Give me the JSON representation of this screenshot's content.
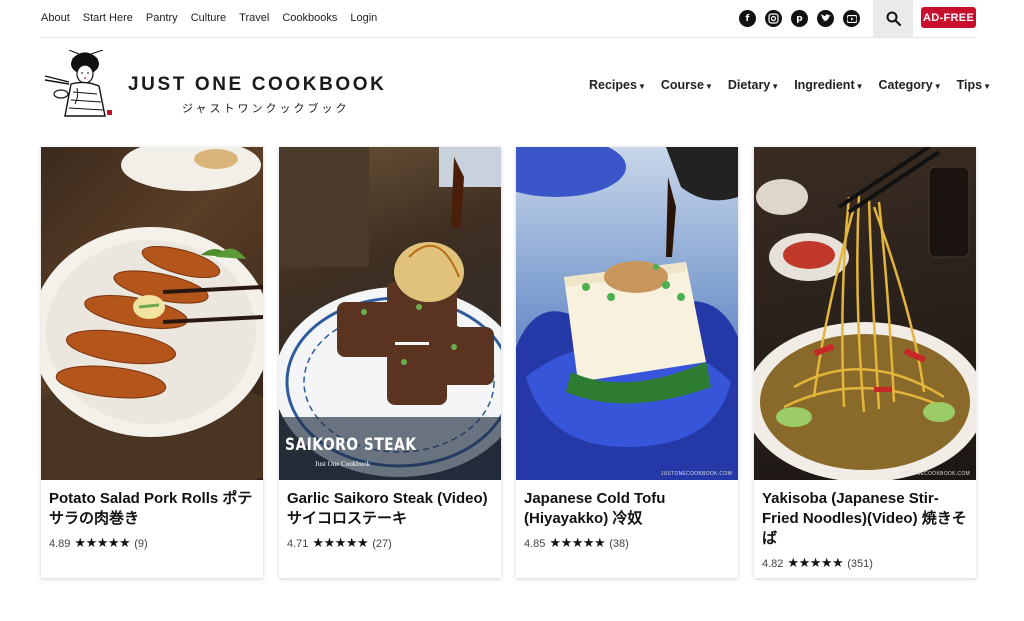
{
  "top_nav": [
    "About",
    "Start Here",
    "Pantry",
    "Culture",
    "Travel",
    "Cookbooks",
    "Login"
  ],
  "social_icons": [
    "facebook-icon",
    "instagram-icon",
    "pinterest-icon",
    "twitter-icon",
    "youtube-icon"
  ],
  "ad_free_label": "AD-FREE",
  "logo": {
    "name": "JUST ONE COOKBOOK",
    "jp": "ジャストワンクックブック"
  },
  "main_nav": [
    {
      "label": "Recipes"
    },
    {
      "label": "Course"
    },
    {
      "label": "Dietary"
    },
    {
      "label": "Ingredient"
    },
    {
      "label": "Category"
    },
    {
      "label": "Tips"
    }
  ],
  "cards": [
    {
      "title": "Potato Salad Pork Rolls ポテサラの肉巻き",
      "rating": "4.89",
      "count": "(9)",
      "stars": "★★★★★"
    },
    {
      "title": "Garlic Saikoro Steak (Video) サイコロステーキ",
      "rating": "4.71",
      "count": "(27)",
      "stars": "★★★★★",
      "overlay_title": "SAIKORO STEAK",
      "overlay_sub": "Just One Cookbook"
    },
    {
      "title": "Japanese Cold Tofu (Hiyayakko) 冷奴",
      "rating": "4.85",
      "count": "(38)",
      "stars": "★★★★★"
    },
    {
      "title": "Yakisoba (Japanese Stir-Fried Noodles)(Video) 焼きそば",
      "rating": "4.82",
      "count": "(351)",
      "stars": "★★★★★"
    }
  ],
  "watermark": "JUSTONECOOKBOOK.COM"
}
